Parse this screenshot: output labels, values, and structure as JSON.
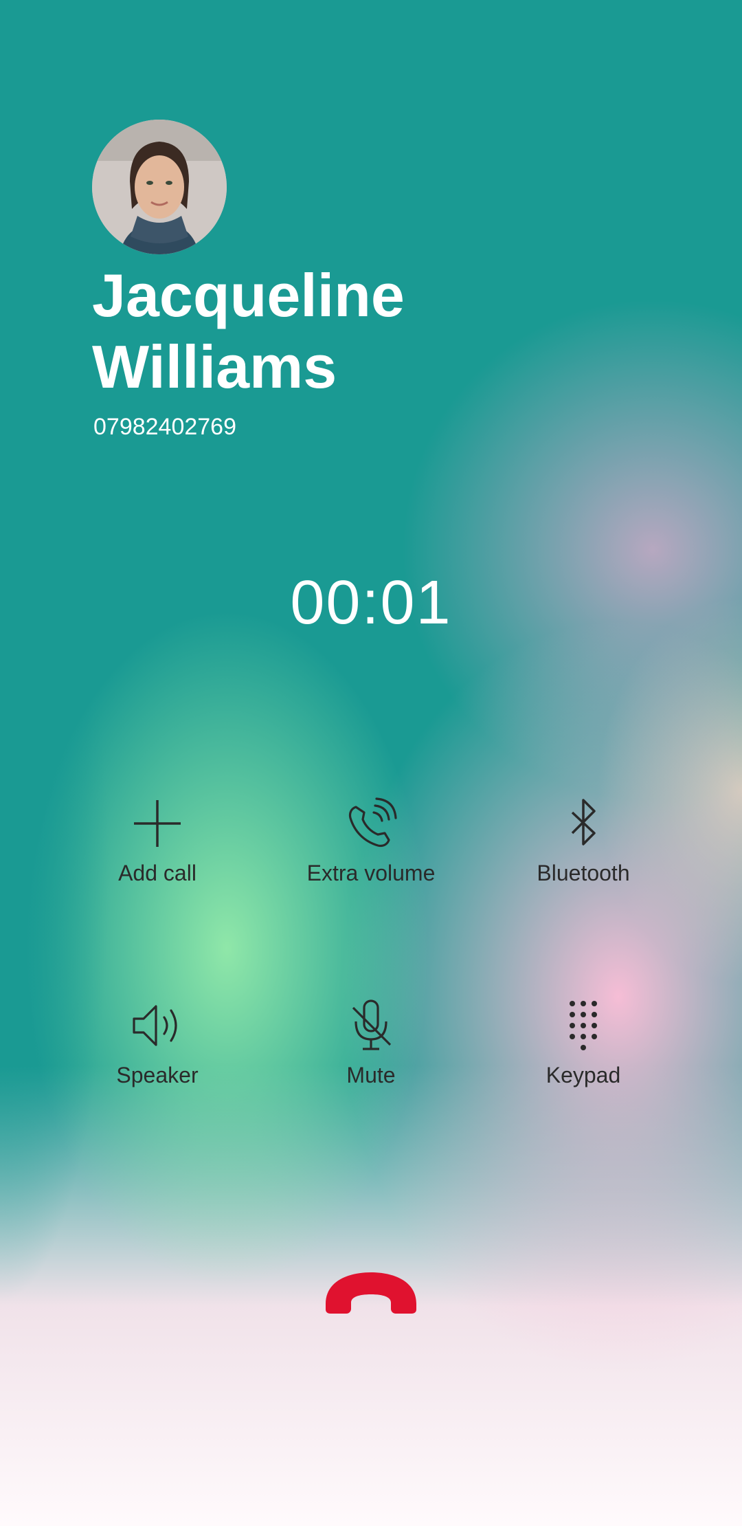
{
  "caller": {
    "name": "Jacqueline Williams",
    "number": "07982402769"
  },
  "call": {
    "timer": "00:01"
  },
  "controls": [
    {
      "label": "Add call",
      "icon": "add-icon"
    },
    {
      "label": "Extra volume",
      "icon": "extra-volume-icon"
    },
    {
      "label": "Bluetooth",
      "icon": "bluetooth-icon"
    },
    {
      "label": "Speaker",
      "icon": "speaker-icon"
    },
    {
      "label": "Mute",
      "icon": "mute-icon"
    },
    {
      "label": "Keypad",
      "icon": "keypad-icon"
    }
  ],
  "end_call": {
    "icon": "end-call-icon",
    "color": "#e0122f"
  },
  "colors": {
    "background_top": "#1a9a93",
    "text_primary": "#ffffff",
    "control_text": "#2a2a2a"
  }
}
